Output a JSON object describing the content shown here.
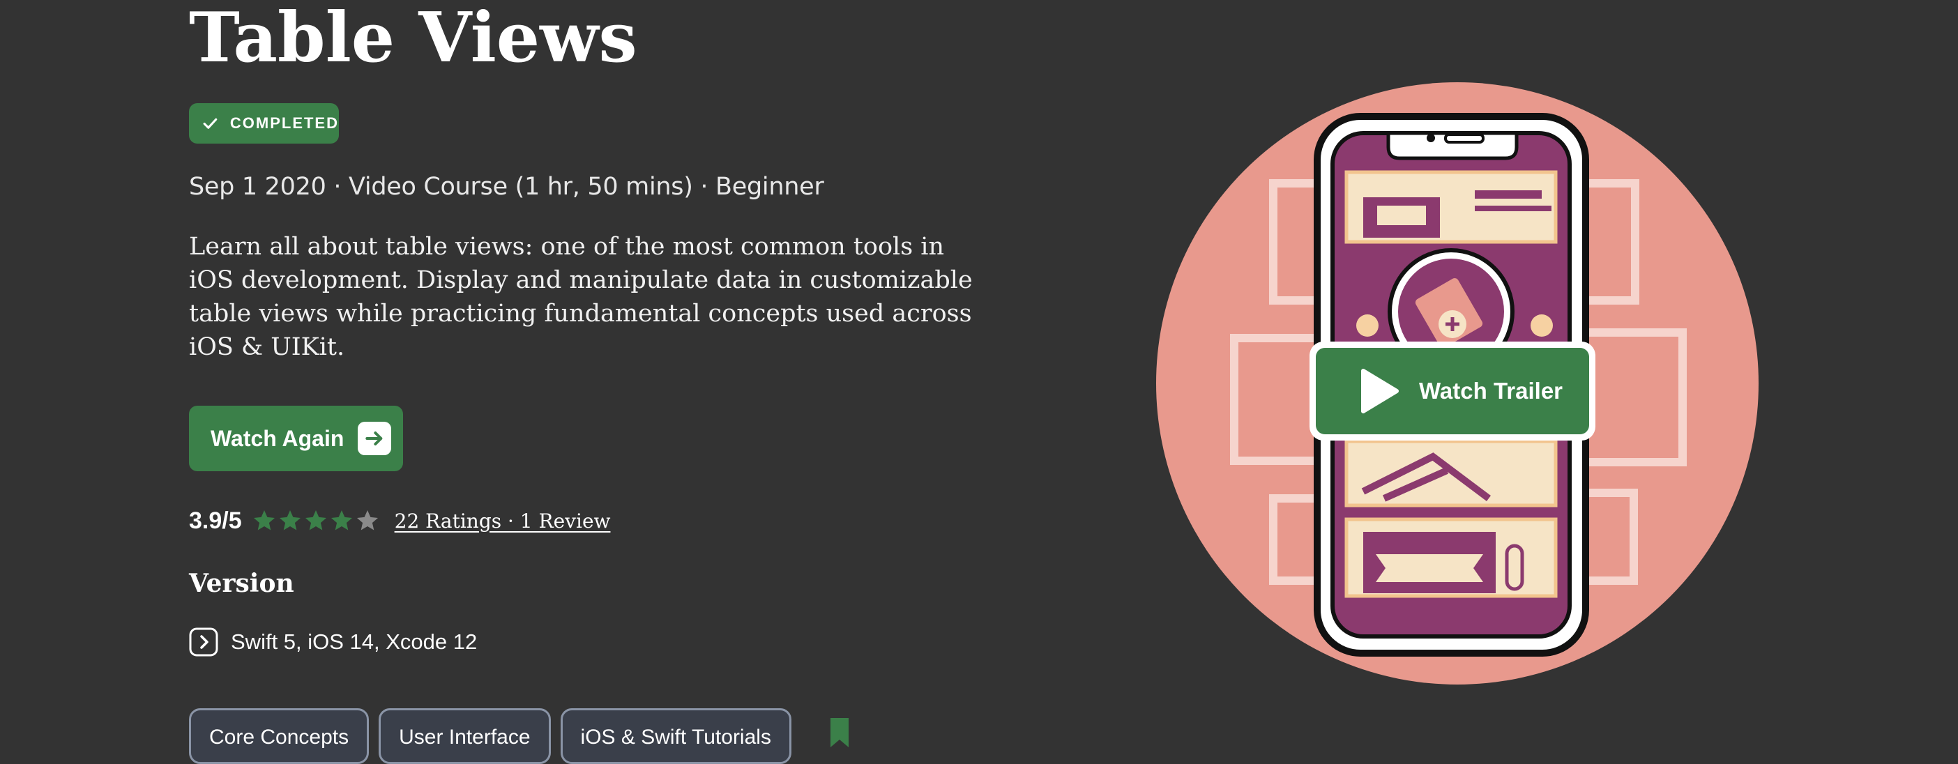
{
  "course": {
    "title": "Table Views",
    "status_badge": "COMPLETED",
    "meta": "Sep 1 2020 · Video Course (1 hr, 50 mins) · Beginner",
    "description": "Learn all about table views: one of the most common tools in iOS development. Display and manipulate data in customizable table views while practicing fundamental concepts used across iOS & UIKit."
  },
  "actions": {
    "watch_again_label": "Watch Again",
    "watch_trailer_label": "Watch Trailer"
  },
  "rating": {
    "score_text": "3.9/5",
    "stars_filled": 4,
    "stars_total": 5,
    "link_text": "22 Ratings · 1 Review"
  },
  "version": {
    "heading": "Version",
    "text": "Swift 5, iOS 14, Xcode 12"
  },
  "tags": [
    "Core Concepts",
    "User Interface",
    "iOS & Swift Tutorials"
  ],
  "icons": {
    "badge": "checkmark-icon",
    "watch_again": "arrow-right-icon",
    "version": "chevron-right-icon",
    "bookmark": "bookmark-icon",
    "trailer": "play-icon"
  },
  "colors": {
    "background": "#333333",
    "accent_green": "#3b8049",
    "star_empty": "#8a8a8a",
    "illustration_circle": "#e8998d",
    "illustration_phone": "#8b3a6e"
  }
}
